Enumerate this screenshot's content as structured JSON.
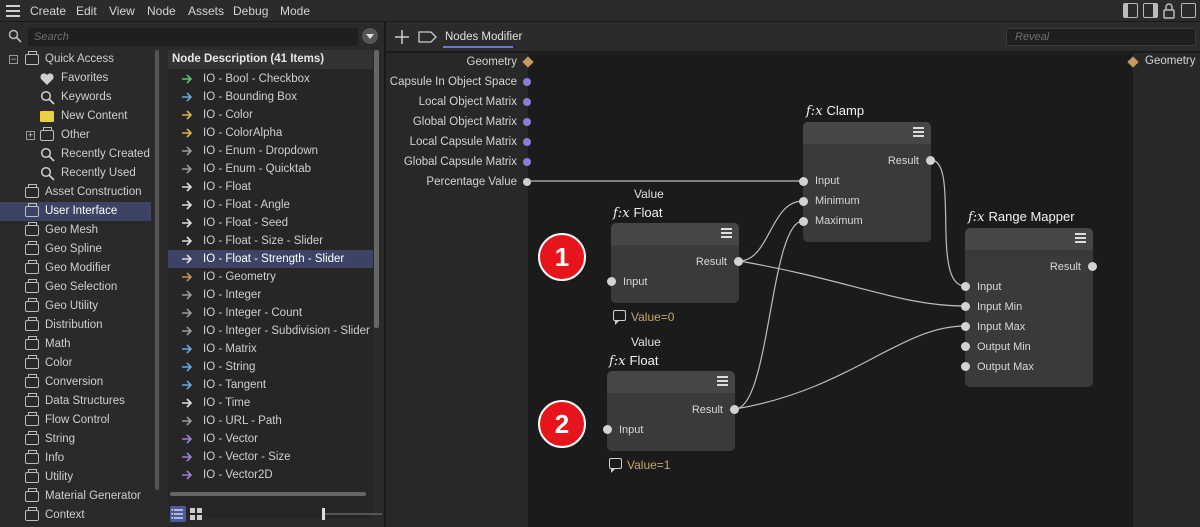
{
  "menu": {
    "items": [
      "Create",
      "Edit",
      "View",
      "Node",
      "Assets",
      "Debug",
      "Mode"
    ]
  },
  "left": {
    "search_placeholder": "Search",
    "tree": [
      {
        "label": "Quick Access",
        "icon": "folder-icon",
        "expand": "minus"
      },
      {
        "label": "Favorites",
        "icon": "heart-icon"
      },
      {
        "label": "Keywords",
        "icon": "search-icon"
      },
      {
        "label": "New Content",
        "icon": "new-content-icon"
      },
      {
        "label": "Other",
        "icon": "folder-icon",
        "expand": "plus"
      },
      {
        "label": "Recently Created",
        "icon": "search-icon"
      },
      {
        "label": "Recently Used",
        "icon": "search-icon"
      },
      {
        "label": "Asset Construction",
        "icon": "folder-icon"
      },
      {
        "label": "User Interface",
        "icon": "folder-icon",
        "selected": true
      },
      {
        "label": "Geo Mesh",
        "icon": "folder-icon"
      },
      {
        "label": "Geo Spline",
        "icon": "folder-icon"
      },
      {
        "label": "Geo Modifier",
        "icon": "folder-icon"
      },
      {
        "label": "Geo Selection",
        "icon": "folder-icon"
      },
      {
        "label": "Geo Utility",
        "icon": "folder-icon"
      },
      {
        "label": "Distribution",
        "icon": "folder-icon"
      },
      {
        "label": "Math",
        "icon": "folder-icon"
      },
      {
        "label": "Color",
        "icon": "folder-icon"
      },
      {
        "label": "Conversion",
        "icon": "folder-icon"
      },
      {
        "label": "Data Structures",
        "icon": "folder-icon"
      },
      {
        "label": "Flow Control",
        "icon": "folder-icon"
      },
      {
        "label": "String",
        "icon": "folder-icon"
      },
      {
        "label": "Info",
        "icon": "folder-icon"
      },
      {
        "label": "Utility",
        "icon": "folder-icon"
      },
      {
        "label": "Material Generator",
        "icon": "folder-icon"
      },
      {
        "label": "Context",
        "icon": "folder-icon"
      }
    ],
    "node_list": {
      "header": "Node Description (41 Items)",
      "items": [
        {
          "label": "IO - Bool - Checkbox",
          "color": "#5fbf6a"
        },
        {
          "label": "IO - Bounding Box",
          "color": "#6aa6d8"
        },
        {
          "label": "IO - Color",
          "color": "#d8b24a"
        },
        {
          "label": "IO - ColorAlpha",
          "color": "#d8b24a"
        },
        {
          "label": "IO - Enum - Dropdown",
          "color": "#9a9a9a"
        },
        {
          "label": "IO - Enum - Quicktab",
          "color": "#9a9a9a"
        },
        {
          "label": "IO - Float",
          "color": "#dcdcdc"
        },
        {
          "label": "IO - Float - Angle",
          "color": "#dcdcdc"
        },
        {
          "label": "IO - Float - Seed",
          "color": "#dcdcdc"
        },
        {
          "label": "IO - Float - Size - Slider",
          "color": "#dcdcdc"
        },
        {
          "label": "IO - Float - Strength - Slider",
          "color": "#dcdcdc",
          "selected": true
        },
        {
          "label": "IO - Geometry",
          "color": "#c0945a"
        },
        {
          "label": "IO - Integer",
          "color": "#9a9a9a"
        },
        {
          "label": "IO - Integer - Count",
          "color": "#9a9a9a"
        },
        {
          "label": "IO - Integer - Subdivision - Slider",
          "color": "#9a9a9a"
        },
        {
          "label": "IO - Matrix",
          "color": "#6aa6d8"
        },
        {
          "label": "IO - String",
          "color": "#6aa6d8"
        },
        {
          "label": "IO - Tangent",
          "color": "#6aa6d8"
        },
        {
          "label": "IO - Time",
          "color": "#dcdcdc"
        },
        {
          "label": "IO - URL - Path",
          "color": "#9a9a9a"
        },
        {
          "label": "IO - Vector",
          "color": "#9b7fd6"
        },
        {
          "label": "IO - Vector - Size",
          "color": "#9b7fd6"
        },
        {
          "label": "IO - Vector2D",
          "color": "#9b7fd6"
        }
      ]
    }
  },
  "editor": {
    "tab_label": "Nodes Modifier",
    "reveal_placeholder": "Reveal",
    "inputs": [
      {
        "label": "Geometry",
        "port": "diamond"
      },
      {
        "label": "Capsule In Object Space",
        "port": "purple"
      },
      {
        "label": "Local Object Matrix",
        "port": "purple"
      },
      {
        "label": "Global Object Matrix",
        "port": "purple"
      },
      {
        "label": "Local Capsule Matrix",
        "port": "purple"
      },
      {
        "label": "Global Capsule Matrix",
        "port": "purple"
      },
      {
        "label": "Percentage Value",
        "port": "white"
      }
    ],
    "output": {
      "label": "Geometry"
    },
    "nodes": {
      "clamp": {
        "title": "Clamp",
        "fx": "f:x",
        "ports_out": [
          "Result"
        ],
        "ports_in": [
          "Input",
          "Minimum",
          "Maximum"
        ]
      },
      "float1": {
        "caption": "Value",
        "title": "Float",
        "fx": "f:x",
        "out": "Result",
        "in": "Input",
        "note": "Value=0"
      },
      "float2": {
        "caption": "Value",
        "title": "Float",
        "fx": "f:x",
        "out": "Result",
        "in": "Input",
        "note": "Value=1"
      },
      "range_mapper": {
        "title": "Range Mapper",
        "fx": "f:x",
        "out": "Result",
        "ports_in": [
          "Input",
          "Input Min",
          "Input Max",
          "Output Min",
          "Output Max"
        ]
      }
    },
    "badges": [
      "1",
      "2"
    ]
  }
}
